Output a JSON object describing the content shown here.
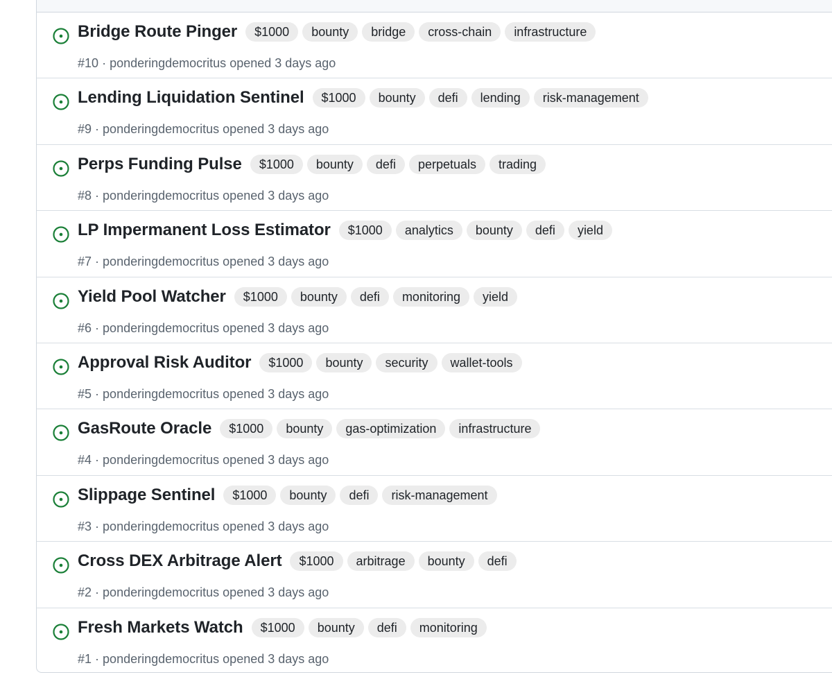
{
  "colors": {
    "open_icon": "#1a7f37",
    "label_bg": "#ececec",
    "meta_text": "#59636e",
    "border": "#d0d7de"
  },
  "issues": [
    {
      "title": "Bridge Route Pinger",
      "labels": [
        "$1000",
        "bounty",
        "bridge",
        "cross-chain",
        "infrastructure"
      ],
      "number": "#10",
      "author": "ponderingdemocritus",
      "opened": "opened 3 days ago"
    },
    {
      "title": "Lending Liquidation Sentinel",
      "labels": [
        "$1000",
        "bounty",
        "defi",
        "lending",
        "risk-management"
      ],
      "number": "#9",
      "author": "ponderingdemocritus",
      "opened": "opened 3 days ago"
    },
    {
      "title": "Perps Funding Pulse",
      "labels": [
        "$1000",
        "bounty",
        "defi",
        "perpetuals",
        "trading"
      ],
      "number": "#8",
      "author": "ponderingdemocritus",
      "opened": "opened 3 days ago"
    },
    {
      "title": "LP Impermanent Loss Estimator",
      "labels": [
        "$1000",
        "analytics",
        "bounty",
        "defi",
        "yield"
      ],
      "number": "#7",
      "author": "ponderingdemocritus",
      "opened": "opened 3 days ago"
    },
    {
      "title": "Yield Pool Watcher",
      "labels": [
        "$1000",
        "bounty",
        "defi",
        "monitoring",
        "yield"
      ],
      "number": "#6",
      "author": "ponderingdemocritus",
      "opened": "opened 3 days ago"
    },
    {
      "title": "Approval Risk Auditor",
      "labels": [
        "$1000",
        "bounty",
        "security",
        "wallet-tools"
      ],
      "number": "#5",
      "author": "ponderingdemocritus",
      "opened": "opened 3 days ago"
    },
    {
      "title": "GasRoute Oracle",
      "labels": [
        "$1000",
        "bounty",
        "gas-optimization",
        "infrastructure"
      ],
      "number": "#4",
      "author": "ponderingdemocritus",
      "opened": "opened 3 days ago"
    },
    {
      "title": "Slippage Sentinel",
      "labels": [
        "$1000",
        "bounty",
        "defi",
        "risk-management"
      ],
      "number": "#3",
      "author": "ponderingdemocritus",
      "opened": "opened 3 days ago"
    },
    {
      "title": "Cross DEX Arbitrage Alert",
      "labels": [
        "$1000",
        "arbitrage",
        "bounty",
        "defi"
      ],
      "number": "#2",
      "author": "ponderingdemocritus",
      "opened": "opened 3 days ago"
    },
    {
      "title": "Fresh Markets Watch",
      "labels": [
        "$1000",
        "bounty",
        "defi",
        "monitoring"
      ],
      "number": "#1",
      "author": "ponderingdemocritus",
      "opened": "opened 3 days ago"
    }
  ]
}
